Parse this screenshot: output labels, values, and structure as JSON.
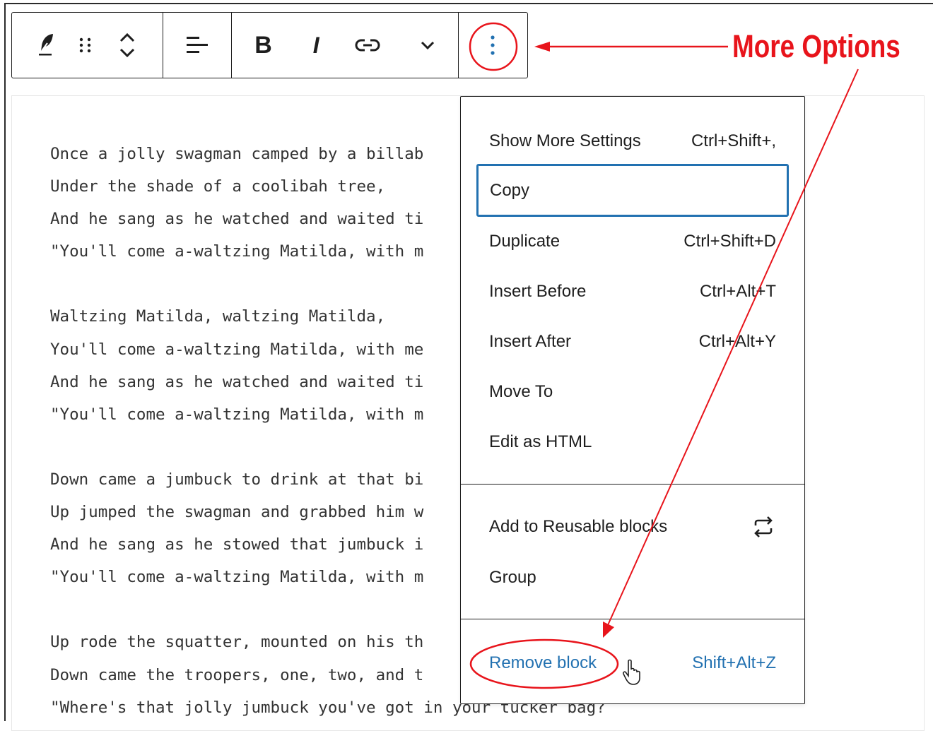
{
  "toolbar": {
    "buttons": [
      "change-block-type",
      "drag",
      "move-up-down",
      "align",
      "bold",
      "italic",
      "link",
      "more-rich-text",
      "more-options"
    ],
    "bold_label": "B",
    "italic_label": "I"
  },
  "poem": {
    "lines": [
      "Once a jolly swagman camped by a billab",
      "Under the shade of a coolibah tree,",
      "And he sang as he watched and waited ti",
      "\"You'll come a-waltzing Matilda, with m",
      "",
      "Waltzing Matilda, waltzing Matilda,",
      "You'll come a-waltzing Matilda, with me",
      "And he sang as he watched and waited ti",
      "\"You'll come a-waltzing Matilda, with m",
      "",
      "Down came a jumbuck to drink at that bi",
      "Up jumped the swagman and grabbed him w",
      "And he sang as he stowed that jumbuck i",
      "\"You'll come a-waltzing Matilda, with m",
      "",
      "Up rode the squatter, mounted on his th",
      "Down came the troopers, one, two, and t",
      "\"Where's that jolly jumbuck you've got in your tucker bag?"
    ]
  },
  "menu": {
    "items": [
      {
        "label": "Show More Settings",
        "shortcut": "Ctrl+Shift+,"
      },
      {
        "label": "Copy",
        "shortcut": ""
      },
      {
        "label": "Duplicate",
        "shortcut": "Ctrl+Shift+D"
      },
      {
        "label": "Insert Before",
        "shortcut": "Ctrl+Alt+T"
      },
      {
        "label": "Insert After",
        "shortcut": "Ctrl+Alt+Y"
      },
      {
        "label": "Move To",
        "shortcut": ""
      },
      {
        "label": "Edit as HTML",
        "shortcut": ""
      },
      {
        "label": "Add to Reusable blocks",
        "shortcut": ""
      },
      {
        "label": "Group",
        "shortcut": ""
      },
      {
        "label": "Remove block",
        "shortcut": "Shift+Alt+Z"
      }
    ],
    "focused_item": "Copy"
  },
  "annotation": {
    "label": "More Options",
    "color": "#e8141b"
  },
  "colors": {
    "accent": "#2271b1",
    "annotation": "#e8141b",
    "text": "#1e1e1e"
  }
}
